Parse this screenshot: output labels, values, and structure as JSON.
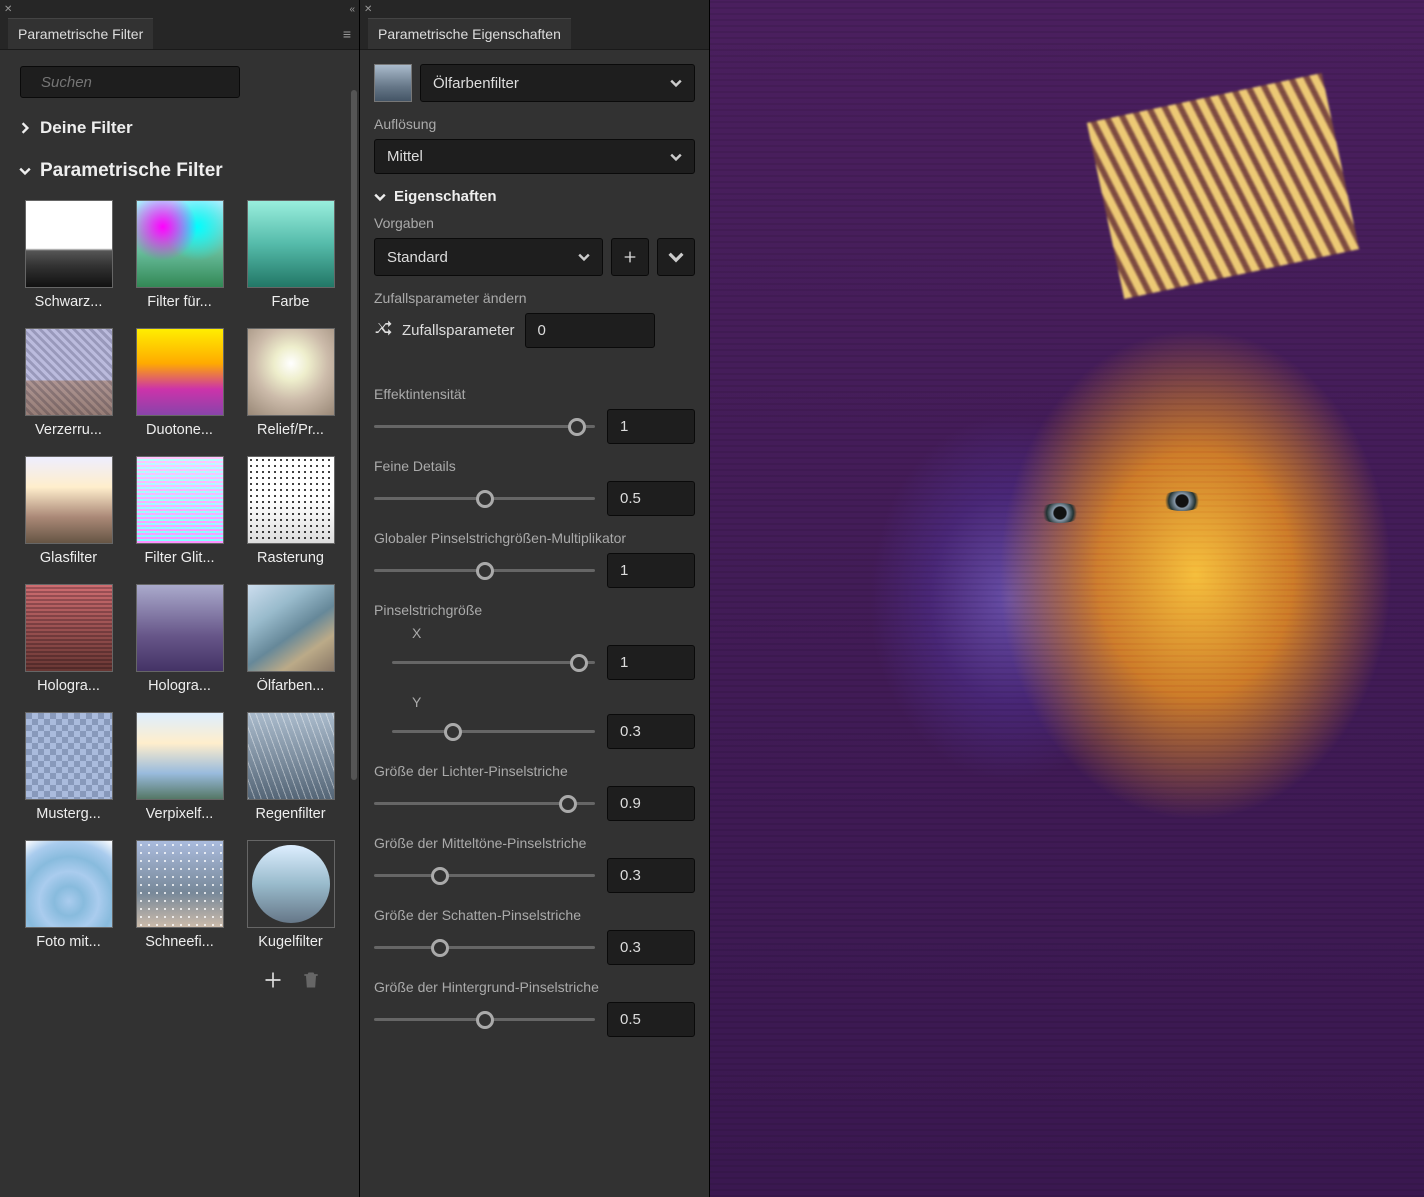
{
  "left": {
    "tab": "Parametrische Filter",
    "search_placeholder": "Suchen",
    "your_filters": "Deine Filter",
    "param_filters": "Parametrische Filter",
    "thumbs": [
      {
        "label": "Schwarz...",
        "cls": "th-bw"
      },
      {
        "label": "Filter für...",
        "cls": "th-chrom"
      },
      {
        "label": "Farbe",
        "cls": "th-color"
      },
      {
        "label": "Verzerru...",
        "cls": "th-distort"
      },
      {
        "label": "Duotone...",
        "cls": "th-duo"
      },
      {
        "label": "Relief/Pr...",
        "cls": "th-relief"
      },
      {
        "label": "Glasfilter",
        "cls": "th-glass"
      },
      {
        "label": "Filter Glit...",
        "cls": "th-glitch"
      },
      {
        "label": "Rasterung",
        "cls": "th-raster"
      },
      {
        "label": "Hologra...",
        "cls": "th-holo1"
      },
      {
        "label": "Hologra...",
        "cls": "th-holo2"
      },
      {
        "label": "Ölfarben...",
        "cls": "th-oil"
      },
      {
        "label": "Musterg...",
        "cls": "th-pattern"
      },
      {
        "label": "Verpixelf...",
        "cls": "th-pixel"
      },
      {
        "label": "Regenfilter",
        "cls": "th-rain"
      },
      {
        "label": "Foto mit...",
        "cls": "th-ripple"
      },
      {
        "label": "Schneefi...",
        "cls": "th-snow"
      },
      {
        "label": "Kugelfilter",
        "cls": "th-sphere"
      }
    ]
  },
  "props": {
    "tab": "Parametrische Eigenschaften",
    "filter_name": "Ölfarbenfilter",
    "resolution_label": "Auflösung",
    "resolution_value": "Mittel",
    "properties_header": "Eigenschaften",
    "presets_label": "Vorgaben",
    "preset_value": "Standard",
    "random_header": "Zufallsparameter ändern",
    "random_label": "Zufallsparameter",
    "random_value": "0",
    "sliders": {
      "effect_intensity": {
        "label": "Effektintensität",
        "value": "1",
        "pos": 92
      },
      "fine_details": {
        "label": "Feine Details",
        "value": "0.5",
        "pos": 50
      },
      "global_brush_mult": {
        "label": "Globaler Pinselstrichgrößen-Multiplikator",
        "value": "1",
        "pos": 50
      },
      "brush_size_header": "Pinselstrichgröße",
      "brush_x": {
        "label": "X",
        "value": "1",
        "pos": 92
      },
      "brush_y": {
        "label": "Y",
        "value": "0.3",
        "pos": 30
      },
      "highlights": {
        "label": "Größe der Lichter-Pinselstriche",
        "value": "0.9",
        "pos": 88
      },
      "midtones": {
        "label": "Größe der Mitteltöne-Pinselstriche",
        "value": "0.3",
        "pos": 30
      },
      "shadows": {
        "label": "Größe der Schatten-Pinselstriche",
        "value": "0.3",
        "pos": 30
      },
      "background": {
        "label": "Größe der Hintergrund-Pinselstriche",
        "value": "0.5",
        "pos": 50
      }
    }
  }
}
